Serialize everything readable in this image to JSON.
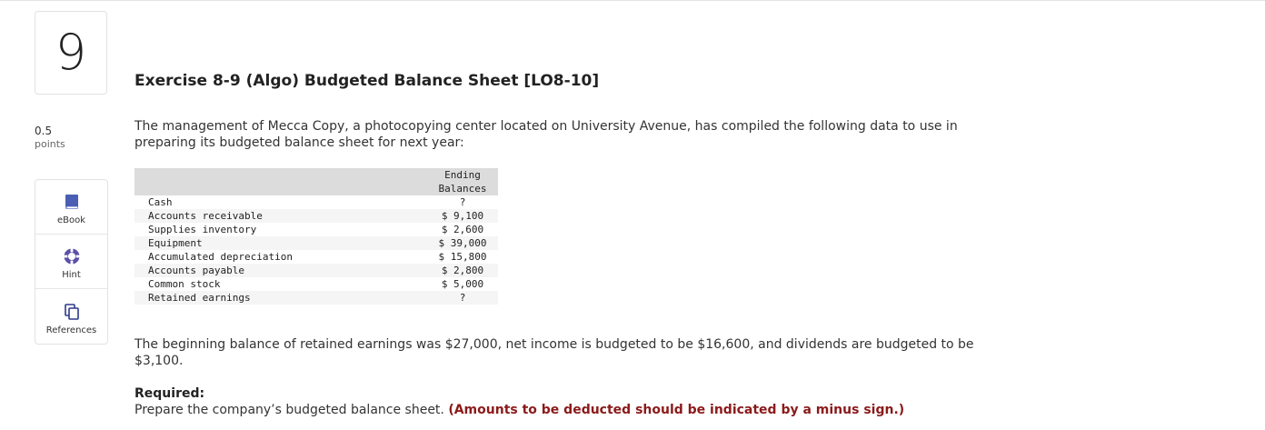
{
  "question": {
    "number": "9",
    "points_value": "0.5",
    "points_label": "points"
  },
  "tools": [
    {
      "label": "eBook",
      "icon": "book-icon"
    },
    {
      "label": "Hint",
      "icon": "lifebuoy-icon"
    },
    {
      "label": "References",
      "icon": "copy-pages-icon"
    }
  ],
  "exercise": {
    "title": "Exercise 8-9 (Algo) Budgeted Balance Sheet [LO8-10]",
    "intro": "The management of Mecca Copy, a photocopying center located on University Avenue, has compiled the following data to use in preparing its budgeted balance sheet for next year:",
    "table": {
      "header_line1": "Ending",
      "header_line2": "Balances",
      "rows": [
        {
          "label": "Cash",
          "value": "?"
        },
        {
          "label": "Accounts receivable",
          "value": "$ 9,100"
        },
        {
          "label": "Supplies inventory",
          "value": "$ 2,600"
        },
        {
          "label": "Equipment",
          "value": "$ 39,000"
        },
        {
          "label": "Accumulated depreciation",
          "value": "$ 15,800"
        },
        {
          "label": "Accounts payable",
          "value": "$ 2,800"
        },
        {
          "label": "Common stock",
          "value": "$ 5,000"
        },
        {
          "label": "Retained earnings",
          "value": "?"
        }
      ]
    },
    "paragraph2": "The beginning balance of retained earnings was $27,000, net income is budgeted to be $16,600, and dividends are budgeted to be $3,100.",
    "required_label": "Required:",
    "instruction_text": "Prepare the company’s budgeted balance sheet.",
    "instruction_note": "(Amounts to be deducted should be indicated by a minus sign.)"
  },
  "colors": {
    "book_icon": "#4a5fb3",
    "hint_icon": "#5b4fa8",
    "references_icon": "#2d3a8c",
    "note_text": "#8b1a1a"
  }
}
